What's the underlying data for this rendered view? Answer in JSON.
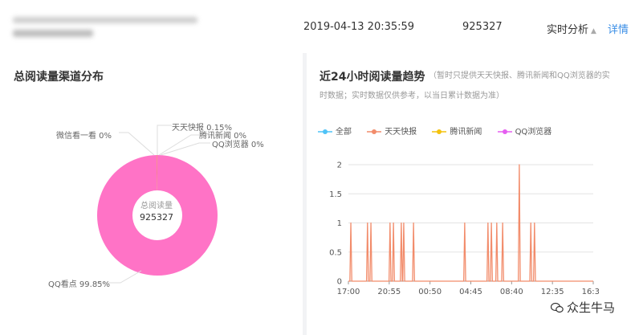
{
  "header": {
    "title_blurred": "",
    "timestamp": "2019-04-13 20:35:59",
    "read_count": "925327",
    "realtime_label": "实时分析",
    "detail_link": "详情"
  },
  "channel_panel": {
    "title": "总阅读量渠道分布",
    "center_label": "总阅读量",
    "center_value": "925327",
    "slice_labels": [
      "天天快报 0.15%",
      "腾讯新闻 0%",
      "QQ浏览器 0%",
      "微信看一看 0%",
      "QQ看点 99.85%"
    ]
  },
  "trend_panel": {
    "title": "近24小时阅读量趋势",
    "note_line1": "（暂时只提供天天快报、腾讯新闻和QQ浏览器的实",
    "note_line2": "时数据；实时数据仅供参考，以当日累计数据为准）",
    "legend": [
      {
        "name": "全部",
        "color": "#4fc3f7"
      },
      {
        "name": "天天快报",
        "color": "#f28c6b"
      },
      {
        "name": "腾讯新闻",
        "color": "#f4c20d"
      },
      {
        "name": "QQ浏览器",
        "color": "#e55ef0"
      }
    ]
  },
  "watermark": "众生牛马",
  "chart_data": [
    {
      "type": "pie",
      "title": "总阅读量渠道分布",
      "categories": [
        "QQ看点",
        "天天快报",
        "腾讯新闻",
        "QQ浏览器",
        "微信看一看"
      ],
      "values": [
        99.85,
        0.15,
        0,
        0,
        0
      ],
      "colors": [
        "#ff73c6",
        "#f28c6b",
        "#f4c20d",
        "#e55ef0",
        "#4fc3f7"
      ],
      "donut": true
    },
    {
      "type": "line",
      "title": "近24小时阅读量趋势",
      "x_tick_labels": [
        "17:00",
        "20:55",
        "00:50",
        "04:45",
        "08:40",
        "12:35",
        "16:30"
      ],
      "ylim": [
        0,
        2
      ],
      "y_ticks": [
        0,
        0.5,
        1,
        1.5,
        2
      ],
      "grid": true,
      "series": [
        {
          "name": "天天快报",
          "color": "#f28c6b",
          "spikes": [
            {
              "x": 0.01,
              "y": 1
            },
            {
              "x": 0.078,
              "y": 1
            },
            {
              "x": 0.092,
              "y": 1
            },
            {
              "x": 0.17,
              "y": 1
            },
            {
              "x": 0.184,
              "y": 1
            },
            {
              "x": 0.216,
              "y": 1
            },
            {
              "x": 0.226,
              "y": 1
            },
            {
              "x": 0.266,
              "y": 1
            },
            {
              "x": 0.475,
              "y": 1
            },
            {
              "x": 0.57,
              "y": 1
            },
            {
              "x": 0.584,
              "y": 1
            },
            {
              "x": 0.606,
              "y": 1
            },
            {
              "x": 0.63,
              "y": 1
            },
            {
              "x": 0.698,
              "y": 2
            },
            {
              "x": 0.745,
              "y": 1
            },
            {
              "x": 0.76,
              "y": 1
            }
          ]
        },
        {
          "name": "全部",
          "color": "#4fc3f7",
          "spikes": []
        },
        {
          "name": "腾讯新闻",
          "color": "#f4c20d",
          "spikes": []
        },
        {
          "name": "QQ浏览器",
          "color": "#e55ef0",
          "spikes": []
        }
      ]
    }
  ]
}
